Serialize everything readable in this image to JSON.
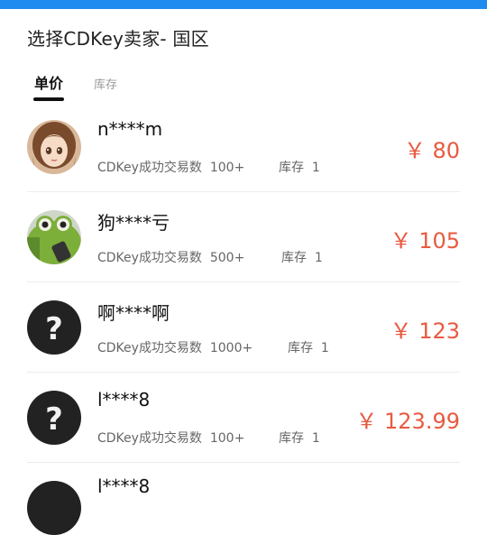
{
  "header": {
    "title": "选择CDKey卖家- 国区"
  },
  "tabs": [
    {
      "label": "单价",
      "active": true
    },
    {
      "label": "库存",
      "active": false
    }
  ],
  "sellers": [
    {
      "name": "n****m",
      "trade_label": "CDKey成功交易数",
      "trades": "100+",
      "stock_label": "库存",
      "stock": "1",
      "price": "￥ 80",
      "avatar": "anime-girl-avatar"
    },
    {
      "name": "狗****亏",
      "trade_label": "CDKey成功交易数",
      "trades": "500+",
      "stock_label": "库存",
      "stock": "1",
      "price": "￥ 105",
      "avatar": "frog-avatar"
    },
    {
      "name": "啊****啊",
      "trade_label": "CDKey成功交易数",
      "trades": "1000+",
      "stock_label": "库存",
      "stock": "1",
      "price": "￥ 123",
      "avatar": "question-mark-avatar"
    },
    {
      "name": "l****8",
      "trade_label": "CDKey成功交易数",
      "trades": "100+",
      "stock_label": "库存",
      "stock": "1",
      "price": "￥ 123.99",
      "avatar": "question-mark-avatar"
    },
    {
      "name": "l****8",
      "avatar": "question-mark-avatar"
    }
  ],
  "colors": {
    "accent": "#1f8bf0",
    "price": "#e85a40"
  }
}
